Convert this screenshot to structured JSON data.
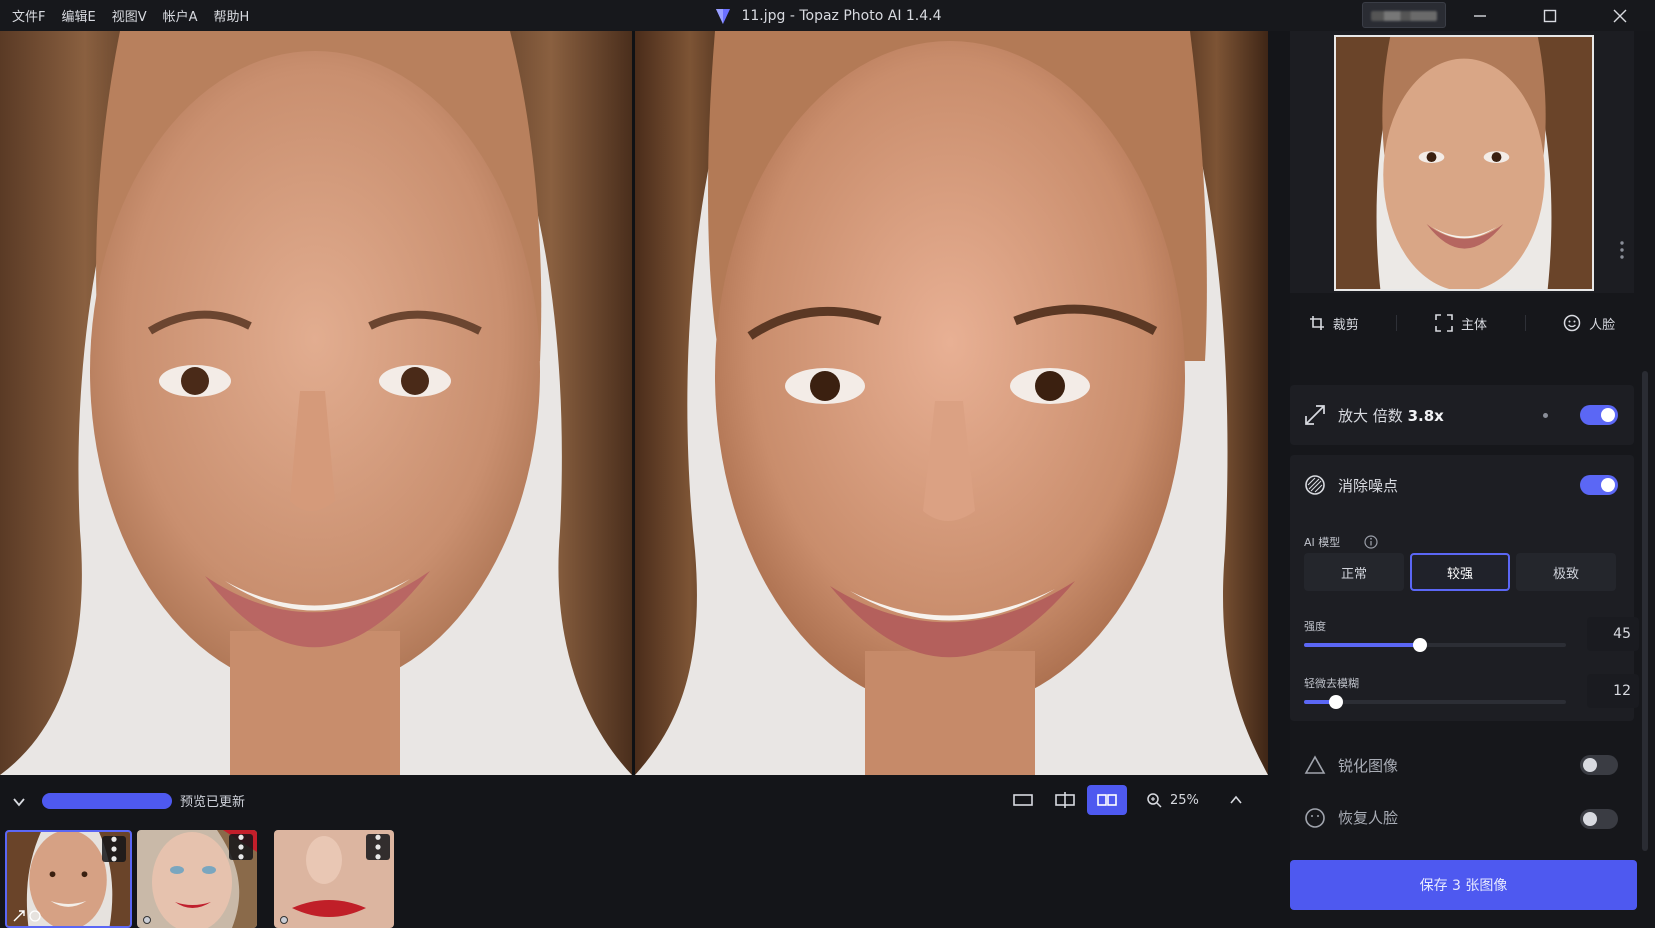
{
  "app": {
    "title": "11.jpg - Topaz Photo AI 1.4.4"
  },
  "menu": {
    "items": [
      "文件F",
      "编辑E",
      "视图V",
      "帐户A",
      "帮助H"
    ]
  },
  "bottom_bar": {
    "status": "预览已更新",
    "zoom": "25%",
    "progress": 1.0
  },
  "sidebar": {
    "tools": {
      "crop": "裁剪",
      "subject": "主体",
      "face": "人脸"
    },
    "upscale": {
      "label": "放大 倍数",
      "value": "3.8x",
      "enabled": true
    },
    "denoise": {
      "label": "消除噪点",
      "enabled": true,
      "model_label": "AI 模型",
      "models": [
        "正常",
        "较强",
        "极致"
      ],
      "selected_model": "较强",
      "strength_label": "强度",
      "strength": "45",
      "deblur_label": "轻微去模糊",
      "deblur": "12"
    },
    "sharpen": {
      "label": "锐化图像",
      "enabled": false
    },
    "recover_face": {
      "label": "恢复人脸",
      "enabled": false
    },
    "save_button": "保存 3 张图像"
  },
  "colors": {
    "accent": "#4e59f0",
    "background": "#141519",
    "panel": "#1d1e23"
  },
  "icons": [
    "crop-icon",
    "subject-icon",
    "face-icon",
    "upscale-icon",
    "denoise-icon",
    "sharpen-icon",
    "info-icon",
    "zoom-icon",
    "chevron-down-icon",
    "chevron-up-icon",
    "more-vertical-icon"
  ]
}
